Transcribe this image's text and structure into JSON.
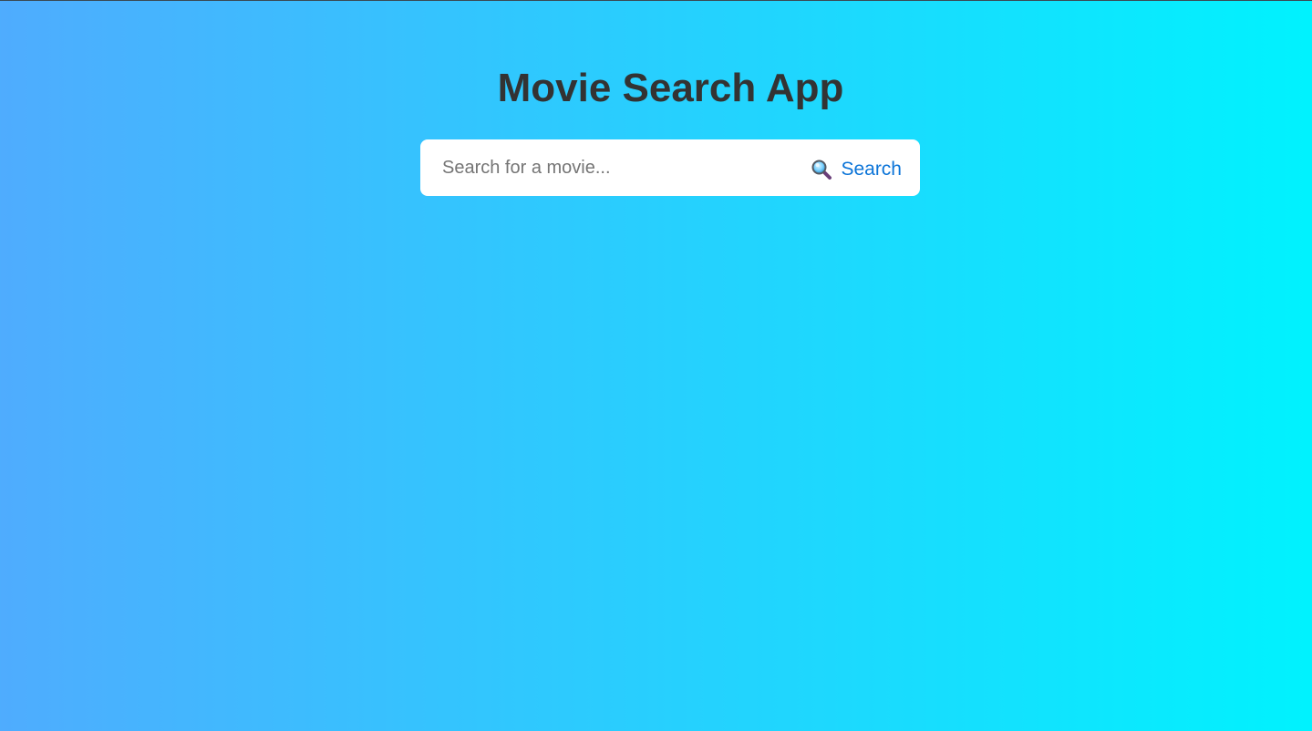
{
  "app": {
    "title": "Movie Search App"
  },
  "search": {
    "placeholder": "Search for a movie...",
    "value": "",
    "button_label": "Search",
    "button_icon": "magnifying-glass-icon"
  },
  "colors": {
    "background_start": "#4facfe",
    "background_end": "#00f2fe",
    "title": "#333333",
    "button_text": "#0b74d8",
    "panel": "#ffffff"
  }
}
